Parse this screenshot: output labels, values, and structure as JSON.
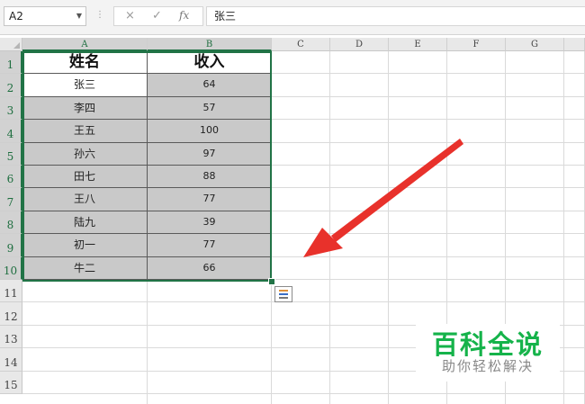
{
  "formula_bar": {
    "name_box": "A2",
    "separator": "⋮",
    "cancel_icon": "×",
    "enter_icon": "✓",
    "function_icon": "fx",
    "formula_value": "张三"
  },
  "sheet": {
    "columns": [
      "A",
      "B",
      "C",
      "D",
      "E",
      "F",
      "G"
    ],
    "rows": [
      "1",
      "2",
      "3",
      "4",
      "5",
      "6",
      "7",
      "8",
      "9",
      "10",
      "11",
      "12",
      "13",
      "14",
      "15"
    ],
    "headers": [
      "姓名",
      "收入"
    ],
    "records": [
      {
        "name": "张三",
        "income": "64"
      },
      {
        "name": "李四",
        "income": "57"
      },
      {
        "name": "王五",
        "income": "100"
      },
      {
        "name": "孙六",
        "income": "97"
      },
      {
        "name": "田七",
        "income": "88"
      },
      {
        "name": "王八",
        "income": "77"
      },
      {
        "name": "陆九",
        "income": "39"
      },
      {
        "name": "初一",
        "income": "77"
      },
      {
        "name": "牛二",
        "income": "66"
      }
    ],
    "selection_color": "#217346",
    "fill_gray": "#c9c9c9"
  },
  "watermark": {
    "title": "百科全说",
    "subtitle": "助你轻松解决",
    "title_color": "#15b34a"
  },
  "annotation": {
    "arrow_color": "#e8312b"
  }
}
